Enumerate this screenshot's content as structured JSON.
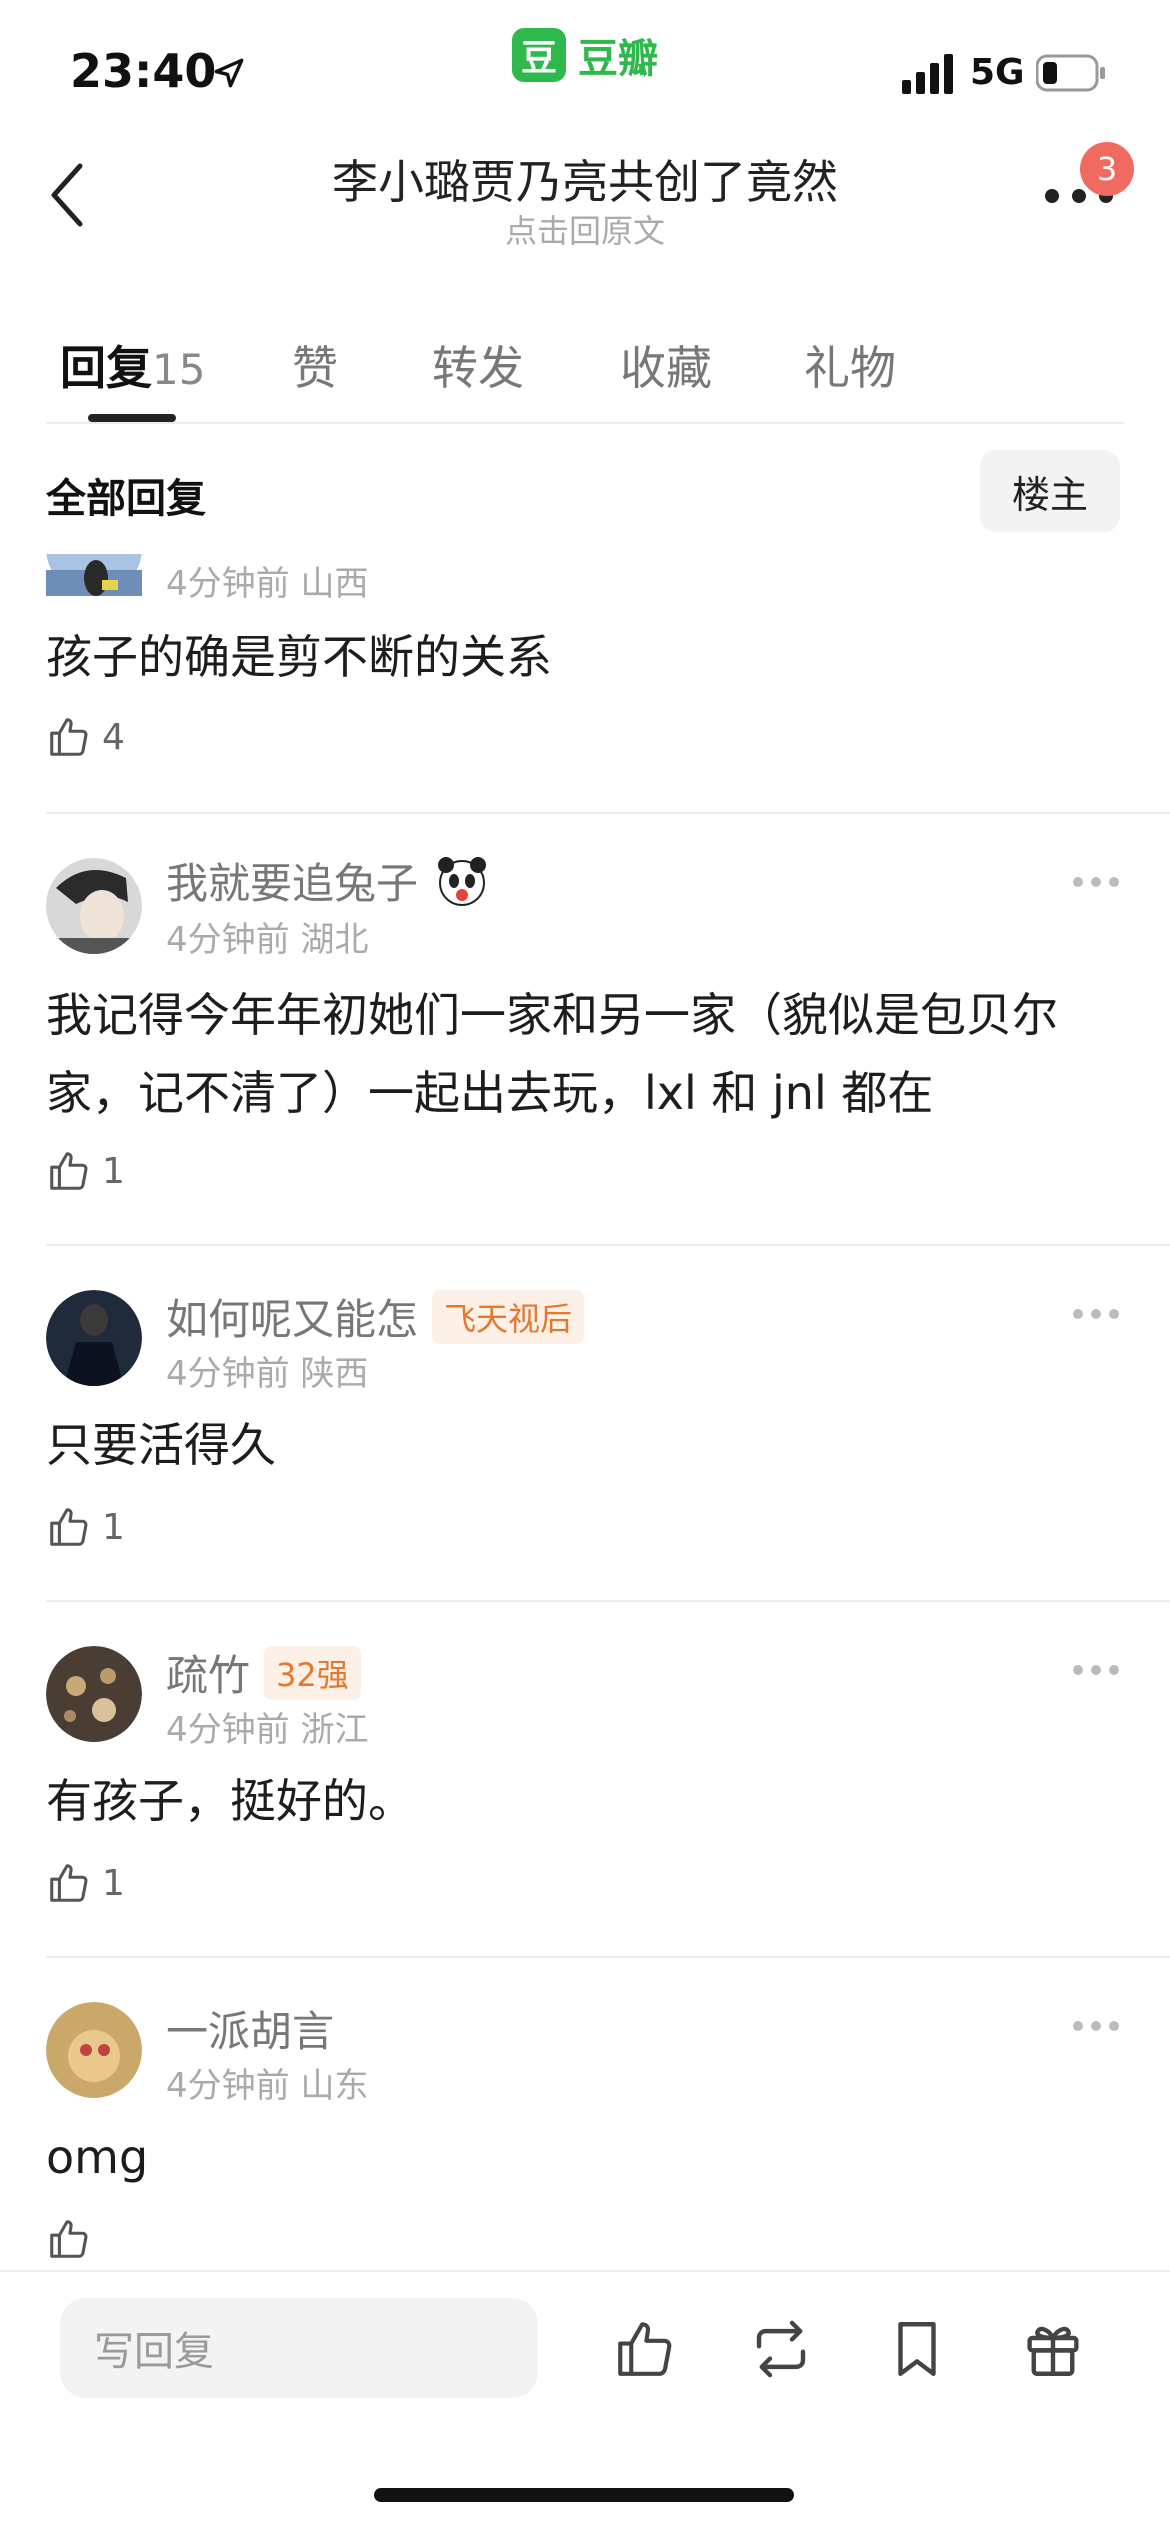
{
  "status_bar": {
    "time": "23:40",
    "network": "5G",
    "app_name": "豆瓣",
    "app_logo_char": "豆"
  },
  "header": {
    "title": "李小璐贾乃亮共创了竟然",
    "subtitle": "点击回原文",
    "notification_count": "3"
  },
  "tabs": [
    {
      "label": "回复",
      "count": "15"
    },
    {
      "label": "赞"
    },
    {
      "label": "转发"
    },
    {
      "label": "收藏"
    },
    {
      "label": "礼物"
    }
  ],
  "filter": {
    "label": "全部回复",
    "op_button": "楼主"
  },
  "comments": [
    {
      "username": "",
      "time": "4分钟前",
      "location": "山西",
      "text": "孩子的确是剪不断的关系",
      "likes": "4"
    },
    {
      "username": "我就要追兔子",
      "time": "4分钟前",
      "location": "湖北",
      "text": "我记得今年年初她们一家和另一家（貌似是包贝尔家，记不清了）一起出去玩，lxl 和 jnl 都在",
      "likes": "1"
    },
    {
      "username": "如何呢又能怎",
      "tag": "飞天视后",
      "time": "4分钟前",
      "location": "陕西",
      "text": "只要活得久",
      "likes": "1"
    },
    {
      "username": "疏竹",
      "tag": "32强",
      "time": "4分钟前",
      "location": "浙江",
      "text": "有孩子，挺好的。",
      "likes": "1"
    },
    {
      "username": "一派胡言",
      "time": "4分钟前",
      "location": "山东",
      "text": "omg",
      "likes": ""
    }
  ],
  "bottom_bar": {
    "reply_placeholder": "写回复",
    "icons": [
      "like-icon",
      "repost-icon",
      "bookmark-icon",
      "gift-icon"
    ]
  },
  "colors": {
    "brand_green": "#2fb94c",
    "badge_red": "#f06a60",
    "tag_orange_text": "#e8772e",
    "tag_orange_bg": "#fdf0e6"
  }
}
